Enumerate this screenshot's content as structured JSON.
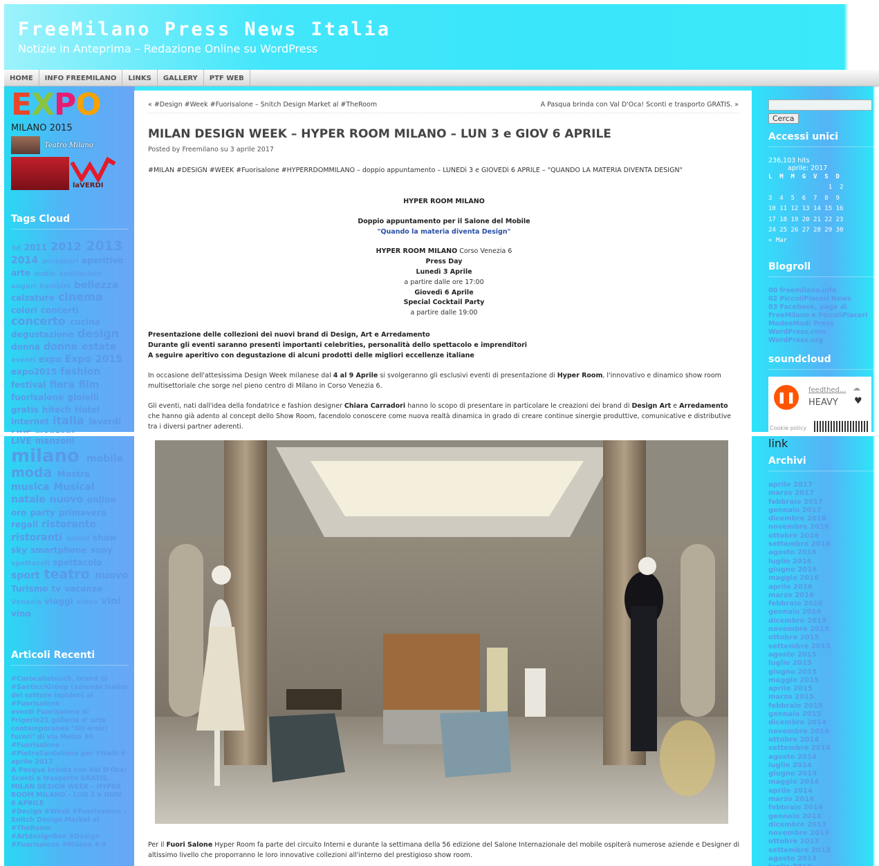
{
  "header": {
    "title": "FreeMilano Press News Italia",
    "tagline": "Notizie in Anteprima – Redazione Online su WordPress"
  },
  "nav": [
    "HOME",
    "INFO FREEMILANO",
    "LINKS",
    "GALLERY",
    "PTF WEB"
  ],
  "left": {
    "expo_logo": "EXPO",
    "expo_caption": "MILANO 2015",
    "teatro_label": "Teatro Milano",
    "verdi_label": "laVERDI",
    "tags_title": "Tags Cloud",
    "tags": [
      [
        "3d",
        1
      ],
      [
        "2011",
        2
      ],
      [
        "2012",
        4
      ],
      [
        "2013",
        5
      ],
      [
        "2014",
        3
      ],
      [
        "accessori",
        1
      ],
      [
        "aperitivo",
        2
      ],
      [
        "arte",
        2
      ],
      [
        "audio",
        1
      ],
      [
        "auditorium",
        1
      ],
      [
        "auguri",
        1
      ],
      [
        "bambini",
        1
      ],
      [
        "bellezza",
        3
      ],
      [
        "calzature",
        2
      ],
      [
        "cinema",
        4
      ],
      [
        "colori",
        2
      ],
      [
        "concerti",
        2
      ],
      [
        "concerto",
        4
      ],
      [
        "cucina",
        2
      ],
      [
        "degustazione",
        2
      ],
      [
        "design",
        4
      ],
      [
        "donna",
        2
      ],
      [
        "donne",
        3
      ],
      [
        "estate",
        3
      ],
      [
        "eventi",
        1
      ],
      [
        "expo",
        2
      ],
      [
        "Expo 2015",
        3
      ],
      [
        "expo2015",
        2
      ],
      [
        "fashion",
        3
      ],
      [
        "festival",
        2
      ],
      [
        "fiera",
        3
      ],
      [
        "film",
        3
      ],
      [
        "fuorisalone",
        2
      ],
      [
        "gioielli",
        2
      ],
      [
        "gratis",
        2
      ],
      [
        "hitech",
        2
      ],
      [
        "Hotel",
        2
      ],
      [
        "internet",
        2
      ],
      [
        "italia",
        4
      ],
      [
        "laverdi",
        2
      ],
      [
        "LIVE",
        2
      ],
      [
        "manzoni",
        2
      ],
      [
        "milano",
        6
      ],
      [
        "mobile",
        3
      ],
      [
        "moda",
        5
      ],
      [
        "Mostra",
        2
      ],
      [
        "musica",
        3
      ],
      [
        "Musical",
        3
      ],
      [
        "natale",
        3
      ],
      [
        "nuovo",
        3
      ],
      [
        "online",
        2
      ],
      [
        "oro",
        2
      ],
      [
        "party",
        2
      ],
      [
        "primavera",
        2
      ],
      [
        "regali",
        2
      ],
      [
        "ristorante",
        3
      ],
      [
        "ristoranti",
        3
      ],
      [
        "saloni",
        1
      ],
      [
        "show",
        2
      ],
      [
        "sky",
        2
      ],
      [
        "smartphone",
        2
      ],
      [
        "sony",
        2
      ],
      [
        "spettacoli",
        1
      ],
      [
        "spettacolo",
        2
      ],
      [
        "sport",
        3
      ],
      [
        "teatro",
        5
      ],
      [
        "nuovo",
        3
      ],
      [
        "Turismo",
        2
      ],
      [
        "tv",
        2
      ],
      [
        "vacanze",
        2
      ],
      [
        "Venezia",
        1
      ],
      [
        "viaggi",
        2
      ],
      [
        "video",
        1
      ],
      [
        "vini",
        3
      ],
      [
        "vino",
        2
      ]
    ],
    "recent_title": "Articoli Recenti",
    "recent": [
      "#Carocallatouch, brand di #SanticciGroup (azienda leader del settore lapideo) al #Fuorisalone",
      "eventi Fuorisalone di Frigerio21 galleria d' arte contemporanea \"Gli eroici furori\" di via Melzo 30 #Fuorisalone – #PietroSantaliona per #Haiti 6 aprile 2017",
      "A Pasqua brinda con Val D'Oca! Sconti e trasporto GRATIS.",
      "MILAN DESIGN WEEK – HYPER ROOM MILANO – LUN 3 e GIOV 6 APRILE",
      "#Design #Week #Fuorisalone – Snitch Design Market al #TheRoom",
      "#ArtdesignBox #Design #Fuorisalone #Milano 4-9"
    ]
  },
  "post": {
    "prev_link": "« #Design #Week #Fuorisalone – Snitch Design Market al #TheRoom",
    "next_link": "A Pasqua brinda con Val D'Oca! Sconti e trasporto GRATIS. »",
    "title": "MILAN DESIGN WEEK – HYPER ROOM MILANO – LUN 3 e GIOV 6 APRILE",
    "meta": "Posted by Freemilano su 3 aprile 2017",
    "intro": "#MILAN #DESIGN #WEEK #Fuorisalone #HYPERRDOMMILANO – doppio appuntamento – LUNEDì 3 e GIOVEDì 6 APRILE – \"QUANDO LA MATERIA DIVENTA DESIGN\"",
    "h1": "HYPER ROOM MILANO",
    "h2": "Doppio appuntamento per il Salone del Mobile",
    "h3": "\"Quando la materia diventa Design\"",
    "addr_bold": "HYPER ROOM MILANO",
    "addr_rest": " Corso Venezia 6",
    "press": "Press Day",
    "mon": "Lunedì 3 Aprile",
    "mon_time": "a partire dalle ore 17:00",
    "thu": "Giovedì 6 Aprile",
    "party": "Special Cocktail Party",
    "thu_time": "a partire dalle 19:00",
    "b1": "Presentazione delle collezioni dei nuovi brand di Design, Art e Arredamento",
    "b2": "Durante gli eventi saranno presenti importanti celebrities, personalità dello spettacolo e imprenditori",
    "b3": "A seguire aperitivo con degustazione di alcuni prodotti delle migliori eccellenze italiane",
    "p1a": "In occasione dell'attesissima Design Week milanese dal ",
    "p1b": "4 al 9 Aprile",
    "p1c": " si svolgeranno gli esclusivi eventi di presentazione di ",
    "p1d": "Hyper Room",
    "p1e": ", l'innovativo e dinamico show room multisettoriale che sorge nel pieno centro di Milano in Corso Venezia 6.",
    "p2a": "Gli eventi, nati dall'idea della fondatrice e fashion designer ",
    "p2b": "Chiara Carradori",
    "p2c": " hanno lo scopo di presentare in particolare le creazioni dei brand di ",
    "p2d": "Design Art",
    "p2e": " e ",
    "p2f": "Arredamento",
    "p2g": " che hanno già adento al concept dello Show Room, facendolo conoscere come nuova realtà dinamica in grado di creare continue sinergie produttive, comunicative e distributive tra i diversi partner aderenti.",
    "p3a": "Per il ",
    "p3b": "Fuori Salone",
    "p3c": " Hyper Room fa parte del circuito Interni e durante la settimana della 56 edizione del Salone Internazionale del mobile ospiterà numerose aziende e Designer di altissimo livello che proporranno le loro innovative collezioni all'interno del prestigioso show room."
  },
  "right": {
    "search_placeholder": "",
    "search_button": "Cerca",
    "accessi_title": "Accessi unici",
    "hits": "236,103 hits",
    "cal_month": "aprile: 2017",
    "cal_head": "L  M  M  G  V  S  D",
    "cal_rows": [
      "                1  2",
      "3  4  5  6  7  8  9",
      "10 11 12 13 14 15 16",
      "17 18 19 20 21 22 23",
      "24 25 26 27 28 29 30"
    ],
    "cal_prev": "« Mar",
    "blogroll_title": "Blogroll",
    "blogroll": [
      "00 freemilano.info",
      "02 PiccoliPiaceri News",
      "03 Facebook, page di FreeMilano e PiccoliPiaceri",
      "ModeeModi Press",
      "WordPress.com",
      "WordPress.org"
    ],
    "soundcloud_title": "soundcloud",
    "sc_user": "feedthed...",
    "sc_track": "HEAVY",
    "sc_cookie": "Cookie policy",
    "link_text": "link",
    "archive_title": "Archivi",
    "archives": [
      "aprile 2017",
      "marzo 2017",
      "febbraio 2017",
      "gennaio 2017",
      "dicembre 2016",
      "novembre 2016",
      "ottobre 2016",
      "settembre 2016",
      "agosto 2016",
      "luglio 2016",
      "giugno 2016",
      "maggio 2016",
      "aprile 2016",
      "marzo 2016",
      "febbraio 2016",
      "gennaio 2016",
      "dicembre 2015",
      "novembre 2015",
      "ottobre 2015",
      "settembre 2015",
      "agosto 2015",
      "luglio 2015",
      "giugno 2015",
      "maggio 2015",
      "aprile 2015",
      "marzo 2015",
      "febbraio 2015",
      "gennaio 2015",
      "dicembre 2014",
      "novembre 2014",
      "ottobre 2014",
      "settembre 2014",
      "agosto 2014",
      "luglio 2014",
      "giugno 2014",
      "maggio 2014",
      "aprile 2014",
      "marzo 2014",
      "febbraio 2014",
      "gennaio 2014",
      "dicembre 2013",
      "novembre 2013",
      "ottobre 2013",
      "settembre 2013",
      "agosto 2013",
      "luglio 2013"
    ]
  }
}
